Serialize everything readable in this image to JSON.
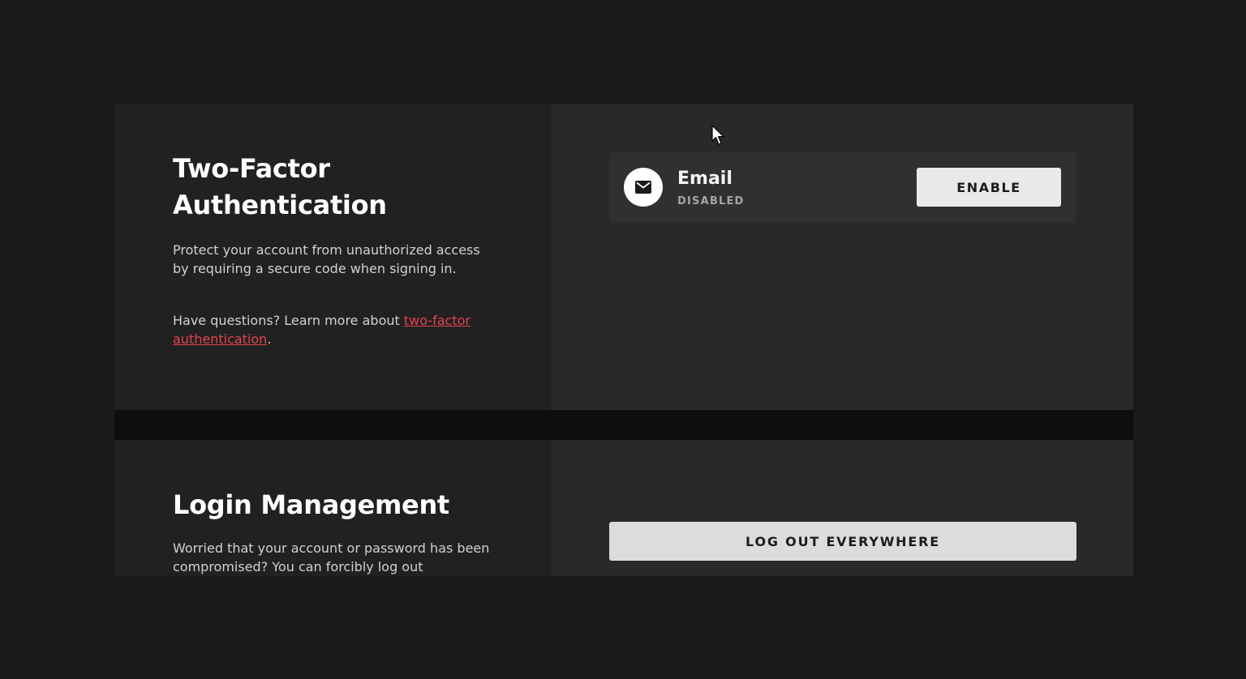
{
  "two_factor": {
    "title": "Two-Factor Authentication",
    "description": "Protect your account from unauthorized access by requiring a secure code when signing in.",
    "questions_prefix": "Have questions? Learn more about ",
    "link_text": "two-factor authentication",
    "questions_suffix": ".",
    "method": {
      "icon": "mail-icon",
      "name": "Email",
      "status": "DISABLED",
      "action_label": "ENABLE"
    }
  },
  "login_management": {
    "title": "Login Management",
    "description": "Worried that your account or password has been compromised? You can forcibly log out",
    "action_label": "LOG OUT EVERYWHERE"
  },
  "colors": {
    "background": "#1b1a1b",
    "panel_left": "#222122",
    "panel_right": "#29282a",
    "accent_link": "#e2434c",
    "button": "#e9e8ea"
  }
}
